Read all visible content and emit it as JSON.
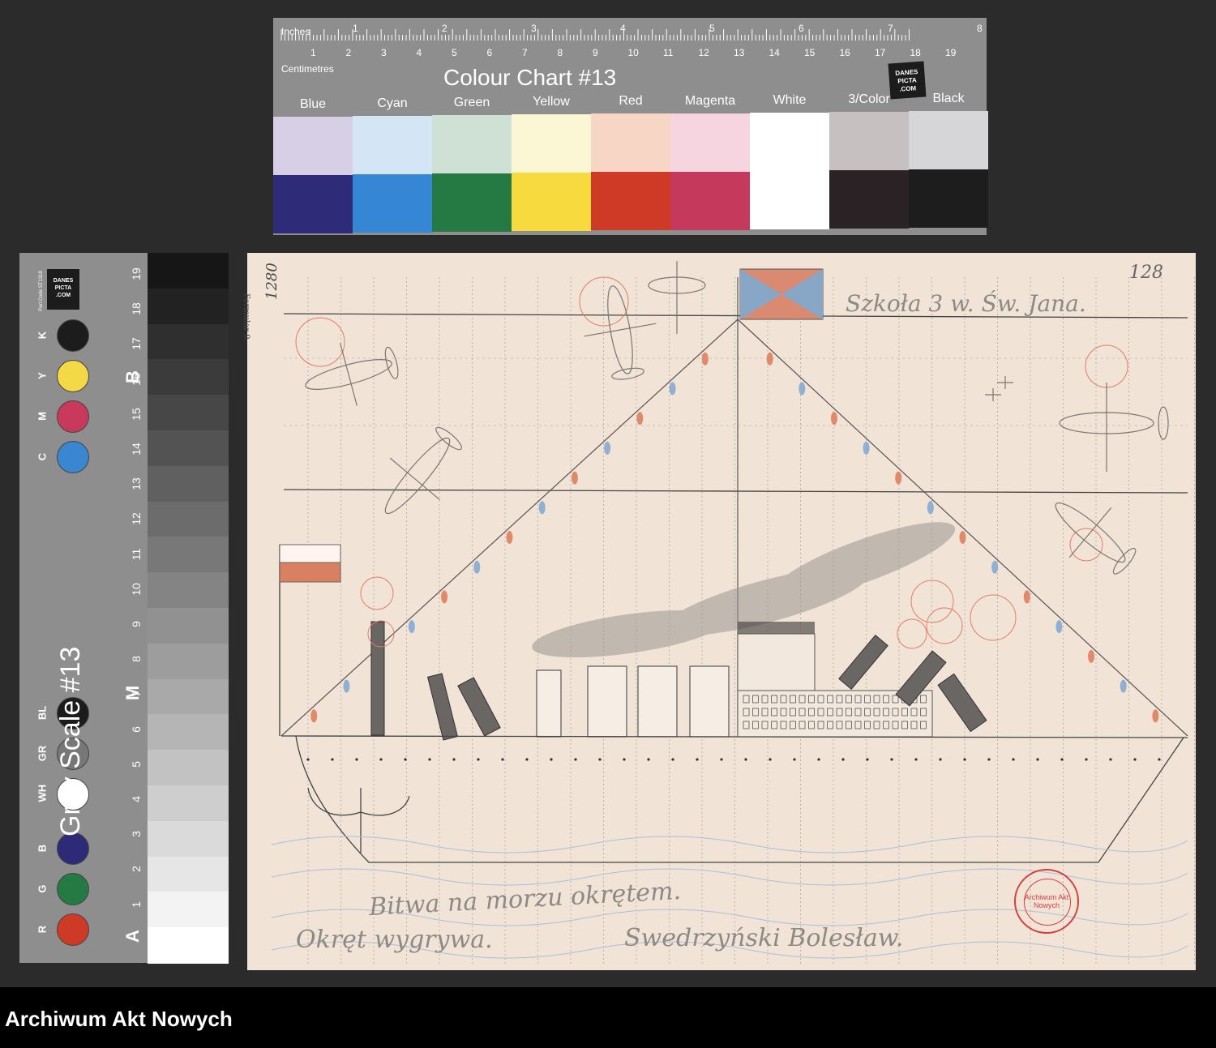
{
  "colour_chart": {
    "title": "Colour Chart #13",
    "inches_label": "Inches",
    "centimetres_label": "Centimetres",
    "inch_numbers": [
      "1",
      "2",
      "3",
      "4",
      "5",
      "6",
      "7",
      "8"
    ],
    "cm_numbers": [
      "1",
      "2",
      "3",
      "4",
      "5",
      "6",
      "7",
      "8",
      "9",
      "10",
      "11",
      "12",
      "13",
      "14",
      "15",
      "16",
      "17",
      "18",
      "19"
    ],
    "logo": "DANES PICTA .COM",
    "swatches": [
      {
        "name": "Blue",
        "light": "#d6cfe6",
        "dark": "#2e2b78"
      },
      {
        "name": "Cyan",
        "light": "#d4e6f6",
        "dark": "#3586d4"
      },
      {
        "name": "Green",
        "light": "#cfe1d4",
        "dark": "#257a44"
      },
      {
        "name": "Yellow",
        "light": "#fbf6d4",
        "dark": "#f7da3d"
      },
      {
        "name": "Red",
        "light": "#f8d6c6",
        "dark": "#cf3a27"
      },
      {
        "name": "Magenta",
        "light": "#f6d4e0",
        "dark": "#c53a5c"
      },
      {
        "name": "White",
        "light": "#ffffff",
        "dark": "#ffffff"
      },
      {
        "name": "3/Color",
        "light": "#c7c0c0",
        "dark": "#2a2224"
      },
      {
        "name": "Black",
        "light": "#d6d6d8",
        "dark": "#1d1d1d"
      }
    ]
  },
  "grey_scale": {
    "title": "Grey Scale #13",
    "logo": "DANES PICTA .COM",
    "part_code": "Part Code ST1318",
    "dots": [
      {
        "label": "K",
        "color": "#1c1c1c"
      },
      {
        "label": "Y",
        "color": "#f3d945"
      },
      {
        "label": "M",
        "color": "#c9395b"
      },
      {
        "label": "C",
        "color": "#3a86d1"
      },
      {
        "label": "BL",
        "color": "#1c1c1c"
      },
      {
        "label": "GR",
        "color": "#777777"
      },
      {
        "label": "WH",
        "color": "#ffffff"
      },
      {
        "label": "B",
        "color": "#2d2b77"
      },
      {
        "label": "G",
        "color": "#257a44"
      },
      {
        "label": "R",
        "color": "#cf3a27"
      }
    ],
    "numbers": [
      "19",
      "18",
      "17",
      "16",
      "15",
      "14",
      "13",
      "12",
      "11",
      "10",
      "9",
      "8",
      "7",
      "6",
      "5",
      "4",
      "3",
      "2",
      "1"
    ],
    "letters": [
      "B",
      "M",
      "A"
    ]
  },
  "drawing": {
    "page_number": "128",
    "formular_label": "Formular 9.",
    "left_margin_number": "1280",
    "school_text": "Szkoła 3 w. Św. Jana.",
    "title_text": "Bitwa na morzu okrętem.",
    "subtitle_text": "Okręt wygrywa.",
    "author_text": "Swedrzyński Bolesław.",
    "stamp_text": "Archiwum Akt Nowych"
  },
  "footer": {
    "institution": "Archiwum Akt Nowych"
  }
}
